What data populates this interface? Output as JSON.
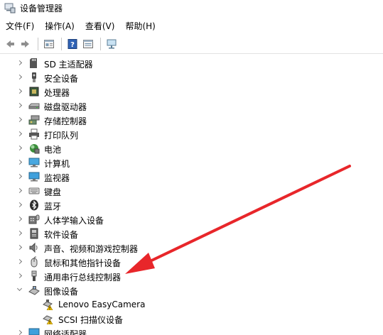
{
  "window": {
    "title": "设备管理器"
  },
  "menu": [
    {
      "label": "文件(F)"
    },
    {
      "label": "操作(A)"
    },
    {
      "label": "查看(V)"
    },
    {
      "label": "帮助(H)"
    }
  ],
  "toolbar": {
    "buttons": [
      "back-arrow-icon",
      "forward-arrow-icon",
      "properties-icon",
      "help-icon",
      "view-icon",
      "monitor-scan-icon"
    ]
  },
  "tree": {
    "items": [
      {
        "label": "SD 主适配器",
        "icon": "sd-card-icon",
        "expanded": false
      },
      {
        "label": "安全设备",
        "icon": "security-key-icon",
        "expanded": false
      },
      {
        "label": "处理器",
        "icon": "cpu-icon",
        "expanded": false
      },
      {
        "label": "磁盘驱动器",
        "icon": "disk-drive-icon",
        "expanded": false
      },
      {
        "label": "存储控制器",
        "icon": "storage-controller-icon",
        "expanded": false
      },
      {
        "label": "打印队列",
        "icon": "printer-icon",
        "expanded": false
      },
      {
        "label": "电池",
        "icon": "battery-icon",
        "expanded": false
      },
      {
        "label": "计算机",
        "icon": "computer-icon",
        "expanded": false
      },
      {
        "label": "监视器",
        "icon": "monitor-icon",
        "expanded": false
      },
      {
        "label": "键盘",
        "icon": "keyboard-icon",
        "expanded": false
      },
      {
        "label": "蓝牙",
        "icon": "bluetooth-icon",
        "expanded": false
      },
      {
        "label": "人体学输入设备",
        "icon": "hid-icon",
        "expanded": false
      },
      {
        "label": "软件设备",
        "icon": "software-device-icon",
        "expanded": false
      },
      {
        "label": "声音、视频和游戏控制器",
        "icon": "speaker-icon",
        "expanded": false
      },
      {
        "label": "鼠标和其他指针设备",
        "icon": "mouse-icon",
        "expanded": false
      },
      {
        "label": "通用串行总线控制器",
        "icon": "usb-icon",
        "expanded": false
      },
      {
        "label": "图像设备",
        "icon": "camera-icon",
        "expanded": true,
        "children": [
          {
            "label": "Lenovo EasyCamera",
            "icon": "camera-warning-icon"
          },
          {
            "label": "SCSI 扫描仪设备",
            "icon": "scanner-warning-icon"
          }
        ]
      },
      {
        "label": "网络适配器",
        "icon": "network-adapter-icon",
        "expanded": false
      }
    ]
  },
  "annotation": {
    "color": "#e8262a"
  }
}
